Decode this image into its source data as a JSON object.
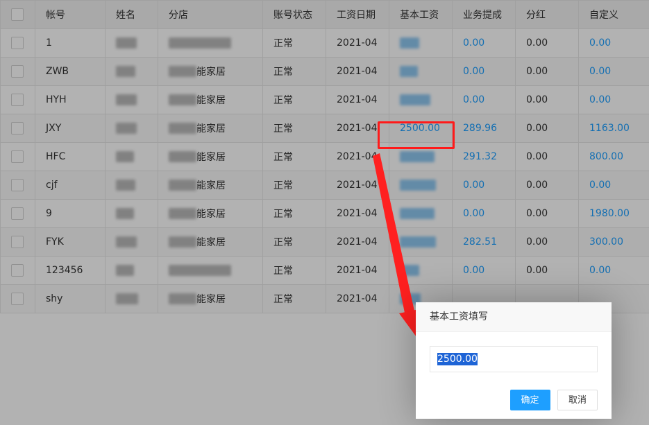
{
  "table": {
    "headers": [
      "帐号",
      "姓名",
      "分店",
      "账号状态",
      "工资日期",
      "基本工资",
      "业务提成",
      "分红",
      "自定义"
    ],
    "rows": [
      {
        "account": "1",
        "name": " ",
        "shop": "",
        "status": "正常",
        "date": "2021-04",
        "base": "",
        "commission": "0.00",
        "dividend": "0.00",
        "custom": "0.00"
      },
      {
        "account": "ZWB",
        "name": " ",
        "shop": "能家居",
        "status": "正常",
        "date": "2021-04",
        "base": "",
        "commission": "0.00",
        "dividend": "0.00",
        "custom": "0.00"
      },
      {
        "account": "HYH",
        "name": " ",
        "shop": "能家居",
        "status": "正常",
        "date": "2021-04",
        "base": "",
        "commission": "0.00",
        "dividend": "0.00",
        "custom": "0.00"
      },
      {
        "account": "JXY",
        "name": " ",
        "shop": "能家居",
        "status": "正常",
        "date": "2021-04",
        "base": "2500.00",
        "commission": "289.96",
        "dividend": "0.00",
        "custom": "1163.00"
      },
      {
        "account": "HFC",
        "name": " ",
        "shop": "能家居",
        "status": "正常",
        "date": "2021-04",
        "base": "",
        "commission": "291.32",
        "dividend": "0.00",
        "custom": "800.00"
      },
      {
        "account": "cjf",
        "name": " ",
        "shop": "能家居",
        "status": "正常",
        "date": "2021-04",
        "base": "",
        "commission": "0.00",
        "dividend": "0.00",
        "custom": "0.00"
      },
      {
        "account": "9",
        "name": " ",
        "shop": "能家居",
        "status": "正常",
        "date": "2021-04",
        "base": "",
        "commission": "0.00",
        "dividend": "0.00",
        "custom": "1980.00"
      },
      {
        "account": "FYK",
        "name": " ",
        "shop": "能家居",
        "status": "正常",
        "date": "2021-04",
        "base": "",
        "commission": "282.51",
        "dividend": "0.00",
        "custom": "300.00"
      },
      {
        "account": "123456",
        "name": " ",
        "shop": "",
        "status": "正常",
        "date": "2021-04",
        "base": "",
        "commission": "0.00",
        "dividend": "0.00",
        "custom": "0.00"
      },
      {
        "account": "shy",
        "name": " ",
        "shop": "能家居",
        "status": "正常",
        "date": "2021-04",
        "base": "",
        "commission": "",
        "dividend": "",
        "custom": ""
      }
    ]
  },
  "dialog": {
    "title": "基本工资填写",
    "input_value": "2500.00",
    "confirm_label": "确定",
    "cancel_label": "取消"
  },
  "colors": {
    "link": "#1e9fff",
    "highlight": "#ff1a1a",
    "primary": "#1e9fff"
  }
}
